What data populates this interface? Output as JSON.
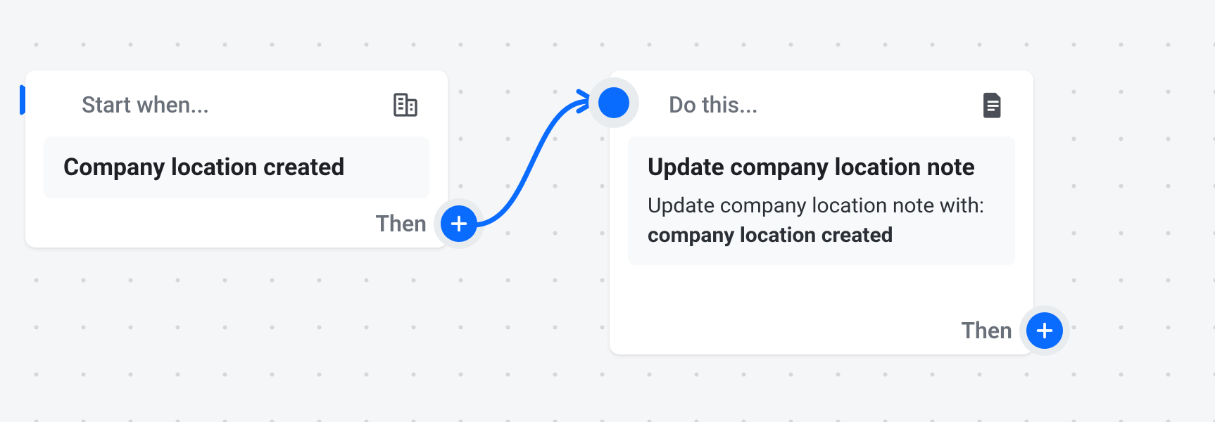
{
  "colors": {
    "accent": "#0a6cff",
    "text_muted": "#6a7079",
    "text_primary": "#1e2025",
    "card_bg": "#ffffff",
    "body_bg": "#f8f9fa",
    "halo": "#e9ecef"
  },
  "start_card": {
    "header_label": "Start when...",
    "icon": "building-icon",
    "body_title": "Company location created",
    "footer_then": "Then"
  },
  "action_card": {
    "header_label": "Do this...",
    "icon": "document-icon",
    "body_title": "Update company location note",
    "body_desc_prefix": "Update company location note with: ",
    "body_desc_bold": "company location created",
    "footer_then": "Then"
  }
}
